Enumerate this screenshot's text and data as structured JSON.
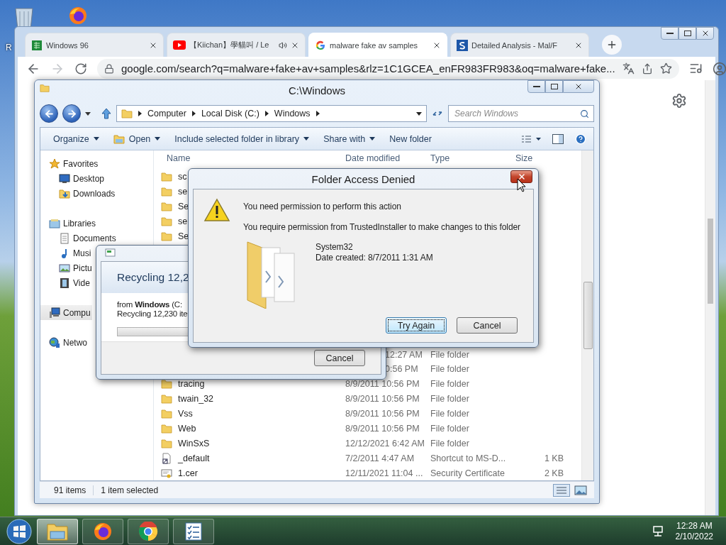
{
  "desktop": {
    "icon_label": "R"
  },
  "browser": {
    "tabs": [
      {
        "label": "Windows 96",
        "kind": "sheet",
        "audio": false,
        "selected": false
      },
      {
        "label": "【Kiichan】學貓叫 / Le",
        "kind": "video",
        "audio": true,
        "selected": false
      },
      {
        "label": "malware fake av samples",
        "kind": "search",
        "audio": false,
        "selected": true
      },
      {
        "label": "Detailed Analysis - Mal/F",
        "kind": "site",
        "audio": false,
        "selected": false
      }
    ],
    "forward_enabled": false,
    "url": "google.com/search?q=malware+fake+av+samples&rlz=1C1GCEA_enFR983FR983&oq=malware+fake..."
  },
  "explorer": {
    "title": "C:\\Windows",
    "breadcrumb": [
      "Computer",
      "Local Disk (C:)",
      "Windows"
    ],
    "search": {
      "placeholder": "Search Windows"
    },
    "toolbar": [
      {
        "label": "Organize",
        "kind": "plain",
        "dropdown": true
      },
      {
        "label": "Open",
        "kind": "open",
        "dropdown": true
      },
      {
        "label": "Include selected folder in library",
        "kind": "plain",
        "dropdown": true
      },
      {
        "label": "Share with",
        "kind": "plain",
        "dropdown": true
      },
      {
        "label": "New folder",
        "kind": "plain",
        "dropdown": false
      }
    ],
    "nav": [
      {
        "label": "Favorites",
        "kind": "favorites",
        "selected": false,
        "children": [
          {
            "label": "Desktop",
            "kind": "desktop",
            "selected": false
          },
          {
            "label": "Downloads",
            "kind": "downloads",
            "selected": false
          }
        ]
      },
      {
        "label": "Libraries",
        "kind": "libraries",
        "selected": false,
        "children": [
          {
            "label": "Documents",
            "kind": "documents",
            "selected": false
          },
          {
            "label": "Musi",
            "kind": "music",
            "selected": false
          },
          {
            "label": "Pictu",
            "kind": "pictures",
            "selected": false
          },
          {
            "label": "Vide",
            "kind": "videos",
            "selected": false
          }
        ]
      },
      {
        "label": "Compu",
        "kind": "computer",
        "selected": true
      },
      {
        "label": "Netwo",
        "kind": "network",
        "selected": false
      }
    ],
    "columns": [
      "Name",
      "Date modified",
      "Type",
      "Size"
    ],
    "rows_top": [
      {
        "name": "sc",
        "kind": "folder"
      },
      {
        "name": "se",
        "kind": "folder"
      },
      {
        "name": "Se",
        "kind": "folder"
      },
      {
        "name": "se",
        "kind": "folder"
      },
      {
        "name": "Se",
        "kind": "folder"
      }
    ],
    "rows_bottom": [
      {
        "date": "12:27 AM",
        "type": "File folder",
        "kind": "partial"
      },
      {
        "date": "0:56 PM",
        "type": "File folder",
        "kind": "partial"
      },
      {
        "name": "tracing",
        "date": "8/9/2011 10:56 PM",
        "type": "File folder",
        "kind": "folder"
      },
      {
        "name": "twain_32",
        "date": "8/9/2011 10:56 PM",
        "type": "File folder",
        "kind": "folder"
      },
      {
        "name": "Vss",
        "date": "8/9/2011 10:56 PM",
        "type": "File folder",
        "kind": "folder"
      },
      {
        "name": "Web",
        "date": "8/9/2011 10:56 PM",
        "type": "File folder",
        "kind": "folder"
      },
      {
        "name": "WinSxS",
        "date": "12/12/2021 6:42 AM",
        "type": "File folder",
        "kind": "folder"
      },
      {
        "name": "_default",
        "date": "7/2/2011 4:47 AM",
        "type": "Shortcut to MS-D...",
        "size": "1 KB",
        "kind": "shortcut"
      },
      {
        "name": "1.cer",
        "date": "12/11/2021 11:04 ...",
        "type": "Security Certificate",
        "size": "2 KB",
        "kind": "certificate"
      }
    ],
    "status": [
      "91 items",
      "1 item selected"
    ]
  },
  "recycle_dialog": {
    "heading": "Recycling 12,2",
    "source": "from **Windows** (C:",
    "progress_text": "Recycling 12,230 ite",
    "level": 0,
    "cancel": "Cancel"
  },
  "access_dialog": {
    "title": "Folder Access Denied",
    "message": "You need permission to perform this action",
    "detail": "You require permission from TrustedInstaller to make changes to this folder",
    "item_name": "System32",
    "item_date": "Date created: 8/7/2011 1:31 AM",
    "buttons": [
      {
        "label": "Try Again",
        "focused": true
      },
      {
        "label": "Cancel",
        "focused": false
      }
    ]
  },
  "taskbar": {
    "apps": [
      {
        "kind": "explorer",
        "active": true
      },
      {
        "kind": "firefox",
        "active": false
      },
      {
        "kind": "chrome",
        "active": false
      },
      {
        "kind": "tasks",
        "active": false
      }
    ],
    "time": "12:28 AM",
    "date": "2/10/2022"
  }
}
